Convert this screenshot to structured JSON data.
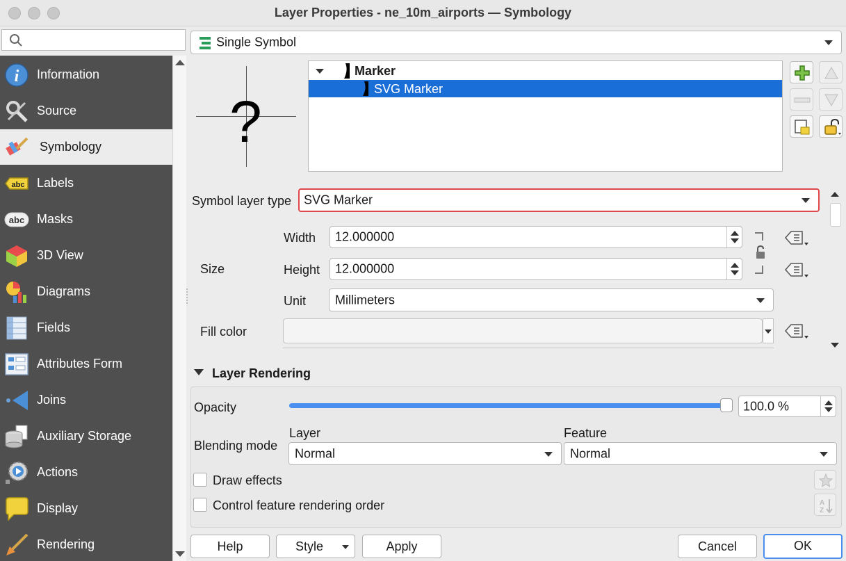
{
  "window": {
    "title": "Layer Properties - ne_10m_airports — Symbology"
  },
  "search": {
    "placeholder": ""
  },
  "sidebar": {
    "items": [
      {
        "label": "Information",
        "icon": "info-icon"
      },
      {
        "label": "Source",
        "icon": "tools-icon"
      },
      {
        "label": "Symbology",
        "icon": "paintbrush-icon",
        "active": true
      },
      {
        "label": "Labels",
        "icon": "abc-label-icon"
      },
      {
        "label": "Masks",
        "icon": "abc-mask-icon"
      },
      {
        "label": "3D View",
        "icon": "cube-icon"
      },
      {
        "label": "Diagrams",
        "icon": "diagram-icon"
      },
      {
        "label": "Fields",
        "icon": "fields-icon"
      },
      {
        "label": "Attributes Form",
        "icon": "form-icon"
      },
      {
        "label": "Joins",
        "icon": "joins-icon"
      },
      {
        "label": "Auxiliary Storage",
        "icon": "storage-icon"
      },
      {
        "label": "Actions",
        "icon": "actions-icon"
      },
      {
        "label": "Display",
        "icon": "speech-bubble-icon"
      },
      {
        "label": "Rendering",
        "icon": "rendering-brush-icon"
      }
    ]
  },
  "renderer": {
    "type": "Single Symbol"
  },
  "symbol_tree": {
    "root": "Marker",
    "child": "SVG Marker"
  },
  "symbol_layer": {
    "type_label": "Symbol layer type",
    "type_value": "SVG Marker"
  },
  "size": {
    "label": "Size",
    "width_label": "Width",
    "width_value": "12.000000",
    "height_label": "Height",
    "height_value": "12.000000",
    "unit_label": "Unit",
    "unit_value": "Millimeters"
  },
  "fill": {
    "label": "Fill color"
  },
  "layer_rendering": {
    "header": "Layer Rendering",
    "opacity_label": "Opacity",
    "opacity_value": "100.0 %",
    "opacity_level": 1.0,
    "blending_label": "Blending mode",
    "layer_label": "Layer",
    "layer_value": "Normal",
    "feature_label": "Feature",
    "feature_value": "Normal",
    "draw_effects": "Draw effects",
    "control_order": "Control feature rendering order"
  },
  "buttons": {
    "help": "Help",
    "style": "Style",
    "apply": "Apply",
    "cancel": "Cancel",
    "ok": "OK"
  },
  "colors": {
    "selection": "#1a6ed8",
    "highlight_border": "#e0474c",
    "sidebar_bg": "#4f4f4f",
    "accent_blue": "#4a8ef0"
  }
}
